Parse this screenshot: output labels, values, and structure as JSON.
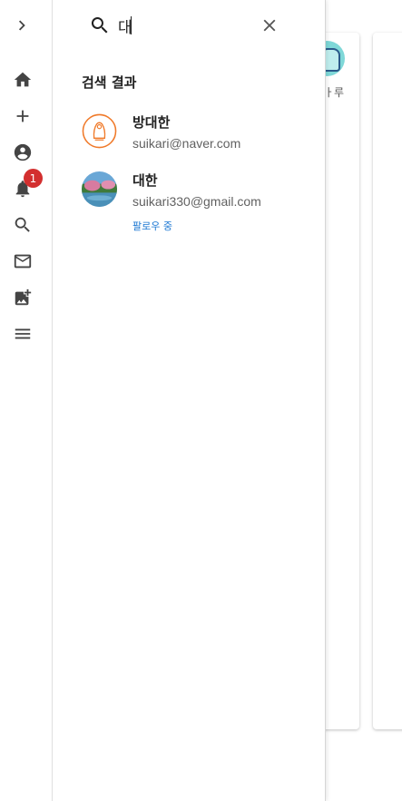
{
  "colors": {
    "accent": "#1976d2",
    "badge": "#d32f2f",
    "icon": "#444444"
  },
  "rail": {
    "toggle_icon": "chevron-right-icon",
    "items": [
      {
        "name": "home-icon"
      },
      {
        "name": "add-icon"
      },
      {
        "name": "account-icon"
      },
      {
        "name": "notifications-icon",
        "badge": "1"
      },
      {
        "name": "search-icon"
      },
      {
        "name": "mail-icon"
      },
      {
        "name": "add-photo-icon"
      },
      {
        "name": "menu-icon"
      }
    ]
  },
  "background": {
    "partial_text": "ㅏ루"
  },
  "search": {
    "query": "대",
    "section_title": "검색 결과",
    "results": [
      {
        "name": "방대한",
        "email": "suikari@naver.com",
        "follow_status": ""
      },
      {
        "name": "대한",
        "email": "suikari330@gmail.com",
        "follow_status": "팔로우 중"
      }
    ]
  }
}
